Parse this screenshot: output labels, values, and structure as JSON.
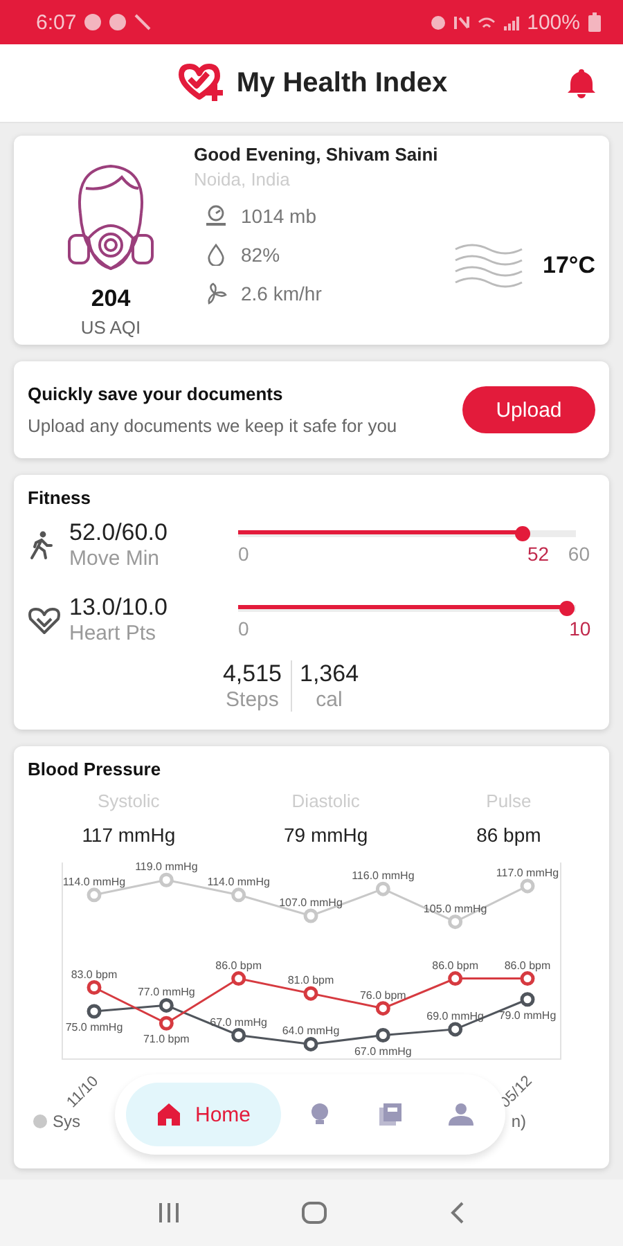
{
  "status_bar": {
    "time": "6:07",
    "battery": "100%"
  },
  "app_bar": {
    "title": "My Health Index"
  },
  "air_card": {
    "aqi": "204",
    "aqi_label": "US AQI",
    "greeting": "Good Evening, Shivam Saini",
    "location": "Noida, India",
    "readings": [
      {
        "kind": "pressure",
        "text": "1014 mb"
      },
      {
        "kind": "humidity",
        "text": "82%"
      },
      {
        "kind": "wind",
        "text": "2.6 km/hr"
      }
    ],
    "temperature": "17°C"
  },
  "upload_card": {
    "title": "Quickly save your documents",
    "text": "Upload any documents we keep it safe for you",
    "button": "Upload"
  },
  "fitness": {
    "title": "Fitness",
    "goals": [
      {
        "kind": "walk",
        "value": "52.0/60.0",
        "label": "Move Min",
        "level": 0.867,
        "min": "0",
        "current": "52",
        "max": "60"
      },
      {
        "kind": "heart",
        "value": "13.0/10.0",
        "label": "Heart Pts",
        "level": 1,
        "min": "0",
        "current": "10"
      }
    ],
    "totals": [
      {
        "value": "4,515",
        "label": "Steps"
      },
      {
        "value": "1,364",
        "label": "cal"
      }
    ]
  },
  "blood_pressure": {
    "title": "Blood Pressure",
    "summary": [
      {
        "label": "Systolic",
        "value": "117 mmHg"
      },
      {
        "label": "Diastolic",
        "value": "79 mmHg"
      },
      {
        "label": "Pulse",
        "value": "86 bpm"
      }
    ],
    "chart_data": {
      "type": "line",
      "categories": [
        "11/10",
        null,
        null,
        null,
        null,
        null,
        "05/12"
      ],
      "series": [
        {
          "color": "#c8c8c8",
          "marker": "circle",
          "values": [
            114,
            119,
            114,
            107,
            116,
            105,
            117
          ],
          "value_labels": [
            "114.0 mmHg",
            "119.0 mmHg",
            "114.0 mmHg",
            "107.0 mmHg",
            "116.0 mmHg",
            "105.0 mmHg",
            "117.0 mmHg"
          ]
        },
        {
          "color": "#50555c",
          "marker": "circle",
          "values": [
            75,
            77,
            67,
            64,
            67,
            69,
            79
          ],
          "value_labels": [
            "75.0 mmHg",
            "77.0 mmHg",
            "67.0 mmHg",
            "64.0 mmHg",
            "67.0 mmHg",
            "69.0 mmHg",
            "79.0 mmHg"
          ]
        },
        {
          "color": "#d63a40",
          "marker": "circle",
          "values": [
            83,
            71,
            86,
            81,
            76,
            86,
            86
          ],
          "value_labels": [
            "83.0 bpm",
            "71.0 bpm",
            "86.0 bpm",
            "81.0 bpm",
            "76.0 bpm",
            "86.0 bpm",
            "86.0 bpm"
          ]
        }
      ]
    },
    "legend": [
      {
        "text": "Sys"
      },
      {
        "text": "n)"
      }
    ]
  },
  "bottom_nav": [
    {
      "kind": "home",
      "label": "Home",
      "selected": true
    },
    {
      "kind": "tips",
      "selected": false
    },
    {
      "kind": "documents",
      "selected": false
    },
    {
      "kind": "profile",
      "selected": false
    }
  ]
}
